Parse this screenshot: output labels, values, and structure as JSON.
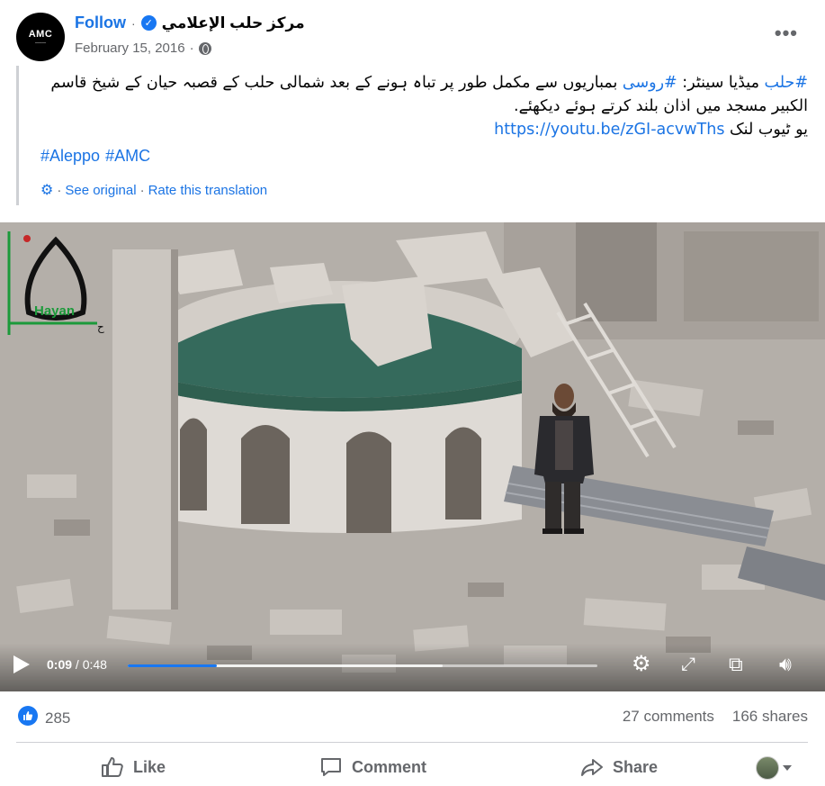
{
  "header": {
    "avatar_text": "AMC",
    "follow_label": "Follow",
    "separator": "·",
    "page_name": "مركز حلب الإعلامي",
    "date": "February 15, 2016",
    "meta_separator": "·",
    "privacy_icon": "globe-icon",
    "more_icon": "more-icon",
    "more_label": "•••"
  },
  "post": {
    "tag_aleppo_ur": "#حلب",
    "text_1": " میڈیا سینٹر: ",
    "tag_russian": "#روسی",
    "text_2": " بمباریوں سے مکمل طور پر تباہ ہونے کے بعد شمالی حلب کے قصبہ حیان کے شیخ قاسم الکبیر مسجد میں اذان بلند کرتے ہوئے دیکھئے.",
    "youtube_label": "یو ٹیوب لنک ",
    "youtube_link": "https://youtu.be/zGI-acvwThs",
    "hashtags": [
      "#Aleppo",
      "#AMC"
    ],
    "see_original": "See original",
    "rate_translation": "Rate this translation",
    "dot": "·"
  },
  "video": {
    "watermark": "Hayan",
    "current_time": "0:09",
    "total_time": " / 0:48",
    "progress": 0.19,
    "buffered": 0.67
  },
  "stats": {
    "likes": "285",
    "comments": "27 comments",
    "shares": "166 shares"
  },
  "actions": {
    "like": "Like",
    "comment": "Comment",
    "share": "Share"
  },
  "colors": {
    "accent": "#1877f2",
    "link": "#1b74e4",
    "muted": "#65676b"
  }
}
